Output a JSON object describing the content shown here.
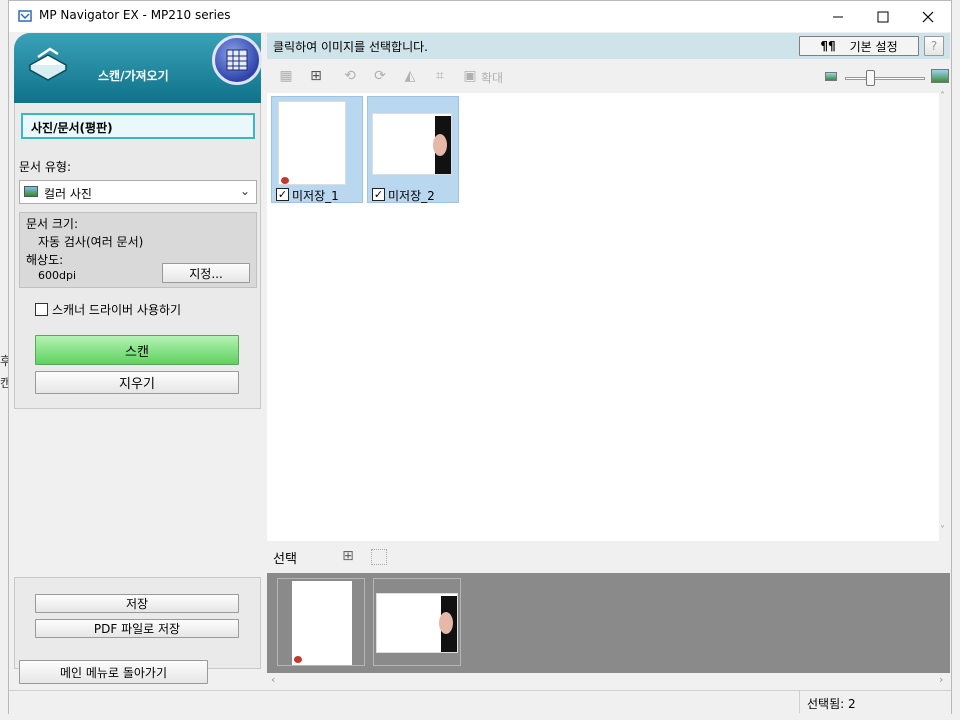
{
  "window": {
    "title": "MP Navigator EX - MP210 series"
  },
  "left_edge": {
    "text1": "후",
    "text2": "캔"
  },
  "left": {
    "header_label": "스캔/가져오기",
    "mode_label": "사진/문서(평판)",
    "doc_type_label": "문서 유형:",
    "doc_type_value": "컬러 사진",
    "doc_size_label": "문서 크기:",
    "doc_size_value": "자동 검사(여러 문서)",
    "resolution_label": "해상도:",
    "resolution_value": "600dpi",
    "specify_button": "지정...",
    "scanner_driver_label": "스캐너 드라이버 사용하기",
    "scan_button": "스캔",
    "clear_button": "지우기",
    "save_button": "저장",
    "save_pdf_button": "PDF 파일로 저장",
    "main_menu_button": "메인 메뉴로 돌아가기"
  },
  "right": {
    "instruction": "클릭하여 이미지를 선택합니다.",
    "preferences_button": "기본 설정",
    "help_button": "?",
    "zoom_label": "확대",
    "thumbnails": [
      {
        "name": "미저장_1",
        "checked": true
      },
      {
        "name": "미저장_2",
        "checked": true
      }
    ],
    "select_label": "선택",
    "status": "선택됨: 2"
  },
  "colors": {
    "header_teal": "#0b6f86",
    "instruction_bar": "#cfe4ea",
    "scan_green": "#5fd15f",
    "tray_gray": "#8a8a8a"
  }
}
